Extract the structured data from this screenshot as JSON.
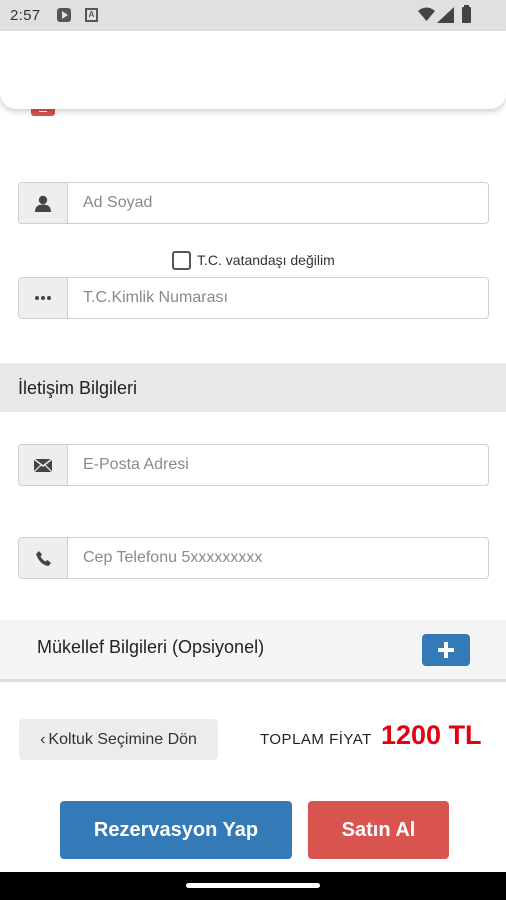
{
  "status_bar": {
    "time": "2:57"
  },
  "form": {
    "name_placeholder": "Ad Soyad",
    "not_citizen_label": "T.C. vatandaşı değilim",
    "id_placeholder": "T.C.Kimlik Numarası"
  },
  "contact": {
    "section_title": "İletişim Bilgileri",
    "email_placeholder": "E-Posta Adresi",
    "phone_placeholder": "Cep Telefonu 5xxxxxxxxx"
  },
  "taxpayer": {
    "title": "Mükellef Bilgileri (Opsiyonel)"
  },
  "footer": {
    "back_label": "Koltuk Seçimine Dön",
    "total_label": "TOPLAM FİYAT",
    "total_value": "1200 TL",
    "reserve_label": "Rezervasyon Yap",
    "buy_label": "Satın Al"
  },
  "icons": {
    "user": "user-icon",
    "dots": "dots-icon",
    "envelope": "envelope-icon",
    "phone": "phone-icon",
    "plus": "plus-icon",
    "chevron": "chevron-left-icon"
  },
  "colors": {
    "primary": "#337ab7",
    "danger": "#d9534f",
    "price": "#e3000f"
  }
}
